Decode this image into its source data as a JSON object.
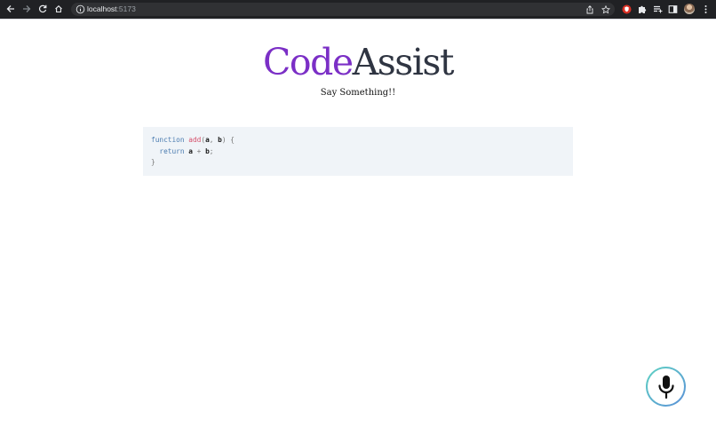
{
  "browser": {
    "url_host": "localhost",
    "url_port": ":5173"
  },
  "header": {
    "title_part1": "Code",
    "title_part2": "Assist",
    "subtitle": "Say Something!!"
  },
  "code_block": {
    "line1": {
      "keyword": "function",
      "name": "add",
      "open_paren": "(",
      "param1": "a",
      "comma": ",",
      "param2": "b",
      "close": ") {"
    },
    "line2": {
      "keyword": "return",
      "left": "a",
      "op": "+",
      "right": "b",
      "semi": ";"
    },
    "line3": {
      "brace": "}"
    }
  },
  "colors": {
    "title_accent": "#7b2fc6",
    "title_dark": "#2f3542",
    "code_keyword": "#4a7bb0",
    "code_function": "#d64f6a",
    "code_background": "#f0f4f8",
    "mic_gradient_start": "#5fd3c3",
    "mic_gradient_end": "#5a8fd8"
  },
  "icons": {
    "back": "arrow-left-icon",
    "forward": "arrow-right-icon",
    "reload": "reload-icon",
    "home": "home-icon",
    "site_info": "info-icon",
    "share": "share-icon",
    "bookmark": "star-icon",
    "extension1": "shield-extension-icon",
    "extensions": "puzzle-icon",
    "reading_list": "reading-list-icon",
    "side_panel": "side-panel-icon",
    "profile": "avatar",
    "menu": "kebab-menu-icon",
    "microphone": "microphone-icon"
  }
}
